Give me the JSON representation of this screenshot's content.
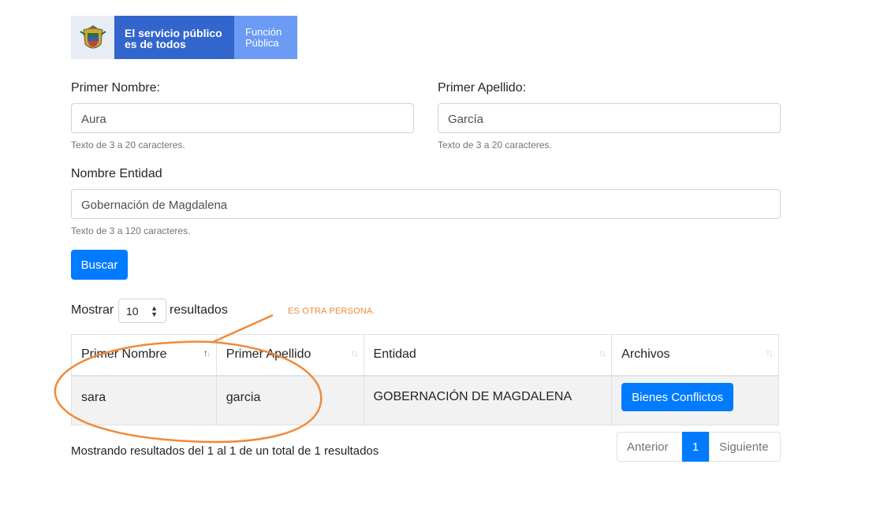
{
  "banner": {
    "slogan_line1": "El servicio público",
    "slogan_line2": "es de todos",
    "brand_line1": "Función",
    "brand_line2": "Pública"
  },
  "form": {
    "first_name": {
      "label": "Primer Nombre:",
      "value": "Aura",
      "help": "Texto de 3 a 20 caracteres."
    },
    "last_name": {
      "label": "Primer Apellido:",
      "value": "García",
      "help": "Texto de 3 a 20 caracteres."
    },
    "entity": {
      "label": "Nombre Entidad",
      "value": "Gobernación de Magdalena",
      "help": "Texto de 3 a 120 caracteres."
    },
    "search_label": "Buscar"
  },
  "length": {
    "prefix": "Mostrar",
    "value": "10",
    "suffix": "resultados"
  },
  "table": {
    "headers": [
      "Primer Nombre",
      "Primer Apellido",
      "Entidad",
      "Archivos"
    ],
    "rows": [
      {
        "first_name": "sara",
        "last_name": "garcia",
        "entity": "GOBERNACIÓN DE MAGDALENA",
        "action": "Bienes Conflictos"
      }
    ]
  },
  "info": "Mostrando resultados del 1 al 1 de un total de 1 resultados",
  "pagination": {
    "prev": "Anterior",
    "current": "1",
    "next": "Siguiente"
  },
  "annotation": {
    "text": "ES OTRA PERSONA.",
    "color": "#f08a3a"
  },
  "colors": {
    "primary": "#007bff",
    "brand": "#3366cc",
    "brand_light": "#6b9bf5"
  }
}
